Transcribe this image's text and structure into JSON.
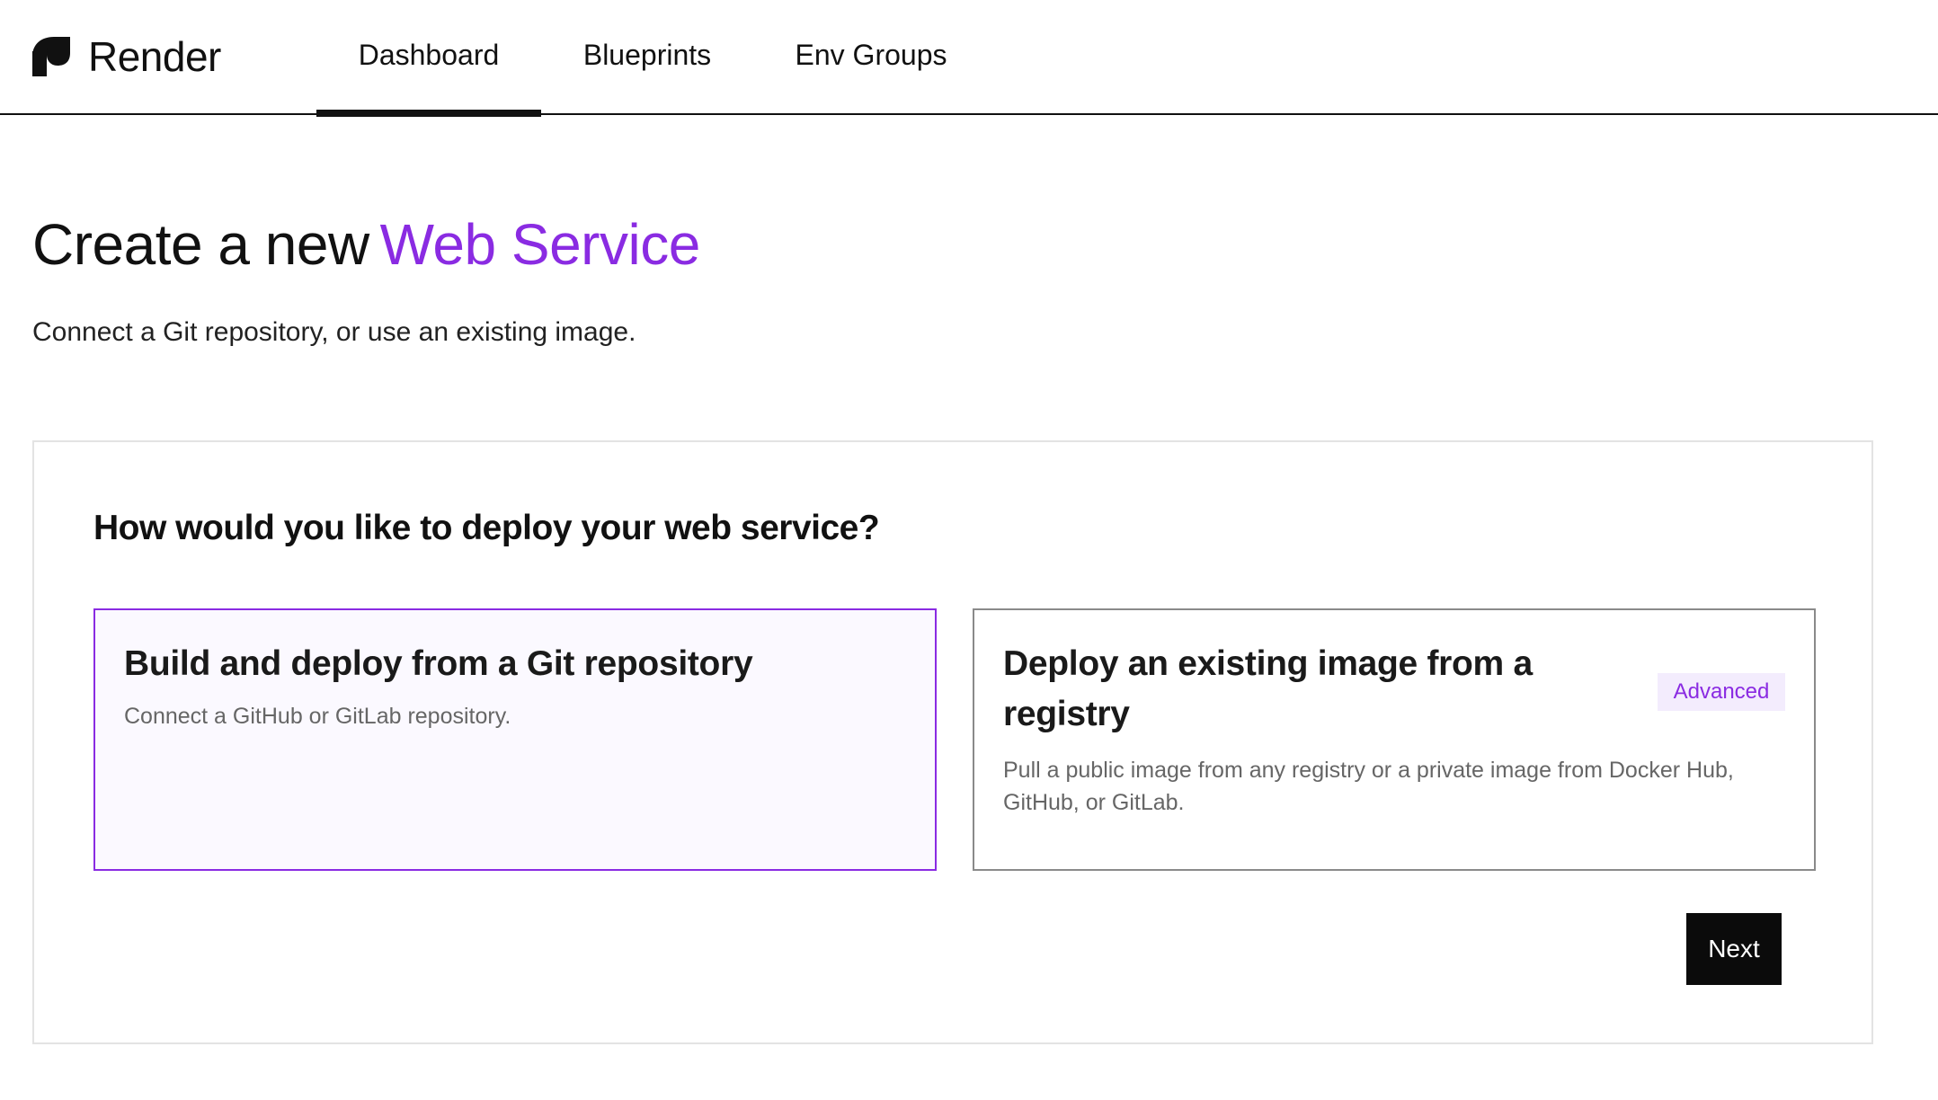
{
  "brand": {
    "name": "Render",
    "icon": "render-logo-icon"
  },
  "nav": {
    "tabs": [
      {
        "label": "Dashboard",
        "active": true
      },
      {
        "label": "Blueprints",
        "active": false
      },
      {
        "label": "Env Groups",
        "active": false
      }
    ]
  },
  "page": {
    "title_prefix": "Create a new",
    "title_accent": "Web Service",
    "subtitle": "Connect a Git repository, or use an existing image."
  },
  "deploy": {
    "question": "How would you like to deploy your web service?",
    "options": [
      {
        "title": "Build and deploy from a Git repository",
        "description": "Connect a GitHub or GitLab repository.",
        "selected": true
      },
      {
        "title": "Deploy an existing image from a registry",
        "description": "Pull a public image from any registry or a private image from Docker Hub, GitHub, or GitLab.",
        "badge": "Advanced",
        "selected": false
      }
    ],
    "next_label": "Next"
  },
  "colors": {
    "accent": "#8a2be2",
    "badge_bg": "#f3ecfd",
    "selected_bg": "#fbf9ff",
    "button_bg": "#0b0b0b",
    "text": "#111111",
    "muted_text": "#666666"
  }
}
